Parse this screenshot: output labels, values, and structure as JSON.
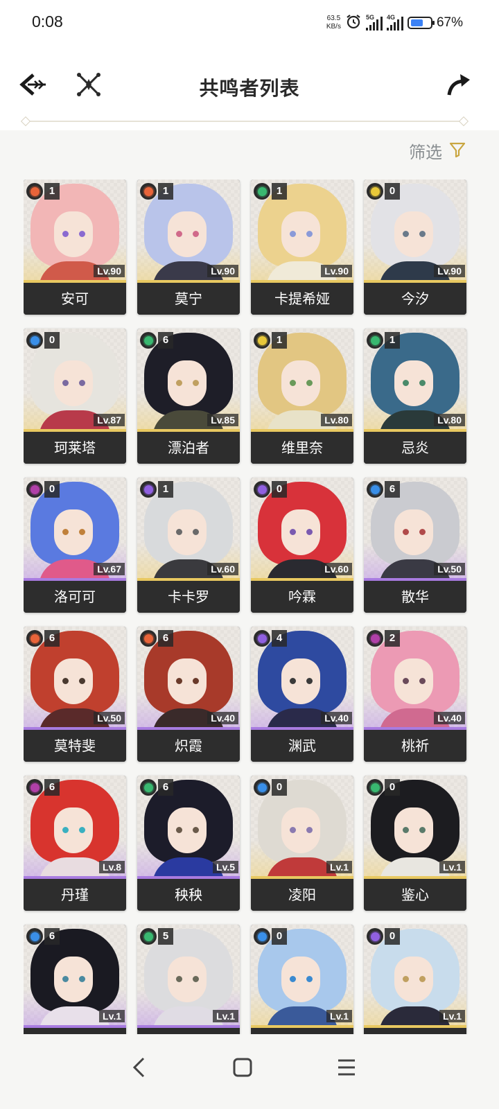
{
  "status_bar": {
    "time": "0:08",
    "net_speed_value": "63.5",
    "net_speed_unit": "KB/s",
    "sim1": "5G",
    "sim2": "4G",
    "battery_text": "67%",
    "battery_level": 0.67
  },
  "header": {
    "title": "共鸣者列表",
    "back_icon": "back-arrow-icon",
    "crossed_swords_icon": "crossed-swords-icon",
    "share_icon": "share-arrow-icon"
  },
  "filter": {
    "label": "筛选",
    "icon": "funnel-icon",
    "icon_color": "#c9a640"
  },
  "element_colors": {
    "fusion": "#e8643a",
    "aero": "#39b870",
    "spectro": "#e8c83a",
    "glacio": "#3a8fe8",
    "havoc": "#b040a8",
    "electro": "#9060e0"
  },
  "characters": [
    {
      "name": "安可",
      "level": "Lv.90",
      "chain": "1",
      "element": "fusion",
      "rarity": 5,
      "hair": "#f2b6b6",
      "eyes": "#8a6ad0",
      "outfit": "#d05a4a"
    },
    {
      "name": "莫宁",
      "level": "Lv.90",
      "chain": "1",
      "element": "fusion",
      "rarity": 5,
      "hair": "#b9c4ea",
      "eyes": "#d06a8a",
      "outfit": "#3a3a4a"
    },
    {
      "name": "卡提希娅",
      "level": "Lv.90",
      "chain": "1",
      "element": "aero",
      "rarity": 5,
      "hair": "#ecd28e",
      "eyes": "#8a9ad8",
      "outfit": "#f0ead8"
    },
    {
      "name": "今汐",
      "level": "Lv.90",
      "chain": "0",
      "element": "spectro",
      "rarity": 5,
      "hair": "#e2e2e6",
      "eyes": "#6a7a8a",
      "outfit": "#2e3a4a"
    },
    {
      "name": "珂莱塔",
      "level": "Lv.87",
      "chain": "0",
      "element": "glacio",
      "rarity": 5,
      "hair": "#e6e4de",
      "eyes": "#7a6aa0",
      "outfit": "#b83a4a"
    },
    {
      "name": "漂泊者",
      "level": "Lv.85",
      "chain": "6",
      "element": "aero",
      "rarity": 5,
      "hair": "#1e1e28",
      "eyes": "#c0a060",
      "outfit": "#4a4a3a"
    },
    {
      "name": "维里奈",
      "level": "Lv.80",
      "chain": "1",
      "element": "spectro",
      "rarity": 5,
      "hair": "#e2c682",
      "eyes": "#6a9a5a",
      "outfit": "#e8e2c8"
    },
    {
      "name": "忌炎",
      "level": "Lv.80",
      "chain": "1",
      "element": "aero",
      "rarity": 5,
      "hair": "#3a6a8a",
      "eyes": "#4a8a6a",
      "outfit": "#2a3a3a"
    },
    {
      "name": "洛可可",
      "level": "Lv.67",
      "chain": "0",
      "element": "havoc",
      "rarity": 4,
      "hair": "#5a7ae0",
      "eyes": "#c0803a",
      "outfit": "#e05a8a"
    },
    {
      "name": "卡卡罗",
      "level": "Lv.60",
      "chain": "1",
      "element": "electro",
      "rarity": 5,
      "hair": "#d8dadc",
      "eyes": "#6a6a6a",
      "outfit": "#3a3a3e"
    },
    {
      "name": "吟霖",
      "level": "Lv.60",
      "chain": "0",
      "element": "electro",
      "rarity": 5,
      "hair": "#d8323a",
      "eyes": "#7a5ab0",
      "outfit": "#2a2a30"
    },
    {
      "name": "散华",
      "level": "Lv.50",
      "chain": "6",
      "element": "glacio",
      "rarity": 4,
      "hair": "#cacbd0",
      "eyes": "#b04a4a",
      "outfit": "#3a3a44"
    },
    {
      "name": "莫特斐",
      "level": "Lv.50",
      "chain": "6",
      "element": "fusion",
      "rarity": 4,
      "hair": "#c0402e",
      "eyes": "#4a3a30",
      "outfit": "#5a2a2a"
    },
    {
      "name": "炽霞",
      "level": "Lv.40",
      "chain": "6",
      "element": "fusion",
      "rarity": 4,
      "hair": "#a83a2a",
      "eyes": "#6a3a2a",
      "outfit": "#3a2a2a"
    },
    {
      "name": "渊武",
      "level": "Lv.40",
      "chain": "4",
      "element": "electro",
      "rarity": 4,
      "hair": "#2e4aa0",
      "eyes": "#3a3a3a",
      "outfit": "#2a2a4a"
    },
    {
      "name": "桃祈",
      "level": "Lv.40",
      "chain": "2",
      "element": "havoc",
      "rarity": 4,
      "hair": "#ec9ab4",
      "eyes": "#6a4a5a",
      "outfit": "#d06a90"
    },
    {
      "name": "丹瑾",
      "level": "Lv.8",
      "chain": "6",
      "element": "havoc",
      "rarity": 4,
      "hair": "#d8342e",
      "eyes": "#3ab0c0",
      "outfit": "#e8dce0"
    },
    {
      "name": "秧秧",
      "level": "Lv.5",
      "chain": "6",
      "element": "aero",
      "rarity": 4,
      "hair": "#1c1c2a",
      "eyes": "#6a5a4a",
      "outfit": "#2a3aa0"
    },
    {
      "name": "凌阳",
      "level": "Lv.1",
      "chain": "0",
      "element": "glacio",
      "rarity": 5,
      "hair": "#dedad2",
      "eyes": "#8a7ab0",
      "outfit": "#c03a3a"
    },
    {
      "name": "鉴心",
      "level": "Lv.1",
      "chain": "0",
      "element": "aero",
      "rarity": 5,
      "hair": "#1c1c20",
      "eyes": "#5a7a6a",
      "outfit": "#e8e6e0"
    },
    {
      "name": "",
      "level": "Lv.1",
      "chain": "6",
      "element": "glacio",
      "rarity": 4,
      "hair": "#1a1a22",
      "eyes": "#4a8aa0",
      "outfit": "#e8e0ea"
    },
    {
      "name": "",
      "level": "Lv.1",
      "chain": "5",
      "element": "aero",
      "rarity": 4,
      "hair": "#dcdcde",
      "eyes": "#6a6a5a",
      "outfit": "#e0dce4"
    },
    {
      "name": "",
      "level": "Lv.1",
      "chain": "0",
      "element": "glacio",
      "rarity": 5,
      "hair": "#a8c8ec",
      "eyes": "#3a8ad0",
      "outfit": "#3a5a9a"
    },
    {
      "name": "",
      "level": "Lv.1",
      "chain": "0",
      "element": "electro",
      "rarity": 5,
      "hair": "#c8dcec",
      "eyes": "#c0a060",
      "outfit": "#2a2a3a"
    }
  ],
  "nav_bar": {
    "back": "nav-back-icon",
    "home": "nav-home-icon",
    "menu": "nav-menu-icon"
  }
}
